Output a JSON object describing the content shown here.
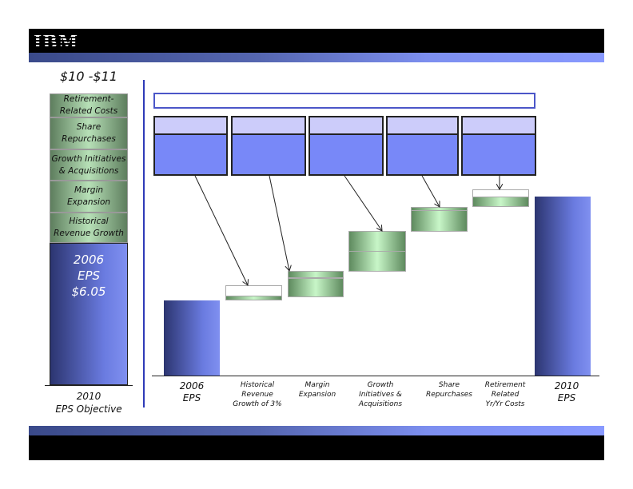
{
  "header": {
    "logo": "IBM"
  },
  "objective": {
    "range": "$10 -$11",
    "blocks": [
      "Retirement-Related Costs",
      "Share Repurchases",
      "Growth Initiatives & Acquisitions",
      "Margin Expansion",
      "Historical Revenue Growth"
    ],
    "base_year": "2006",
    "base_label": "EPS",
    "base_value": "$6.05",
    "footer_year": "2010",
    "footer_label": "EPS Objective"
  },
  "chart_data": {
    "type": "bar",
    "subtype": "waterfall",
    "categories": [
      "2006 EPS",
      "Historical Revenue Growth of 3%",
      "Margin Expansion",
      "Growth Initiatives & Acquisitions",
      "Share Repurchases",
      "Retirement Related Yr/Yr Costs",
      "2010 EPS"
    ],
    "labels": [
      {
        "l1": "2006",
        "l2": "EPS"
      },
      {
        "l1": "Historical",
        "l2": "Revenue",
        "l3": "Growth of 3%"
      },
      {
        "l1": "Margin",
        "l2": "Expansion"
      },
      {
        "l1": "Growth",
        "l2": "Initiatives &",
        "l3": "Acquisitions"
      },
      {
        "l1": "Share",
        "l2": "Repurchases"
      },
      {
        "l1": "Retirement",
        "l2": "Related",
        "l3": "Yr/Yr Costs"
      },
      {
        "l1": "2010",
        "l2": "EPS"
      }
    ],
    "colors": {
      "total": "#6a7be0",
      "step": "#b7e0b7",
      "callout": "#7888f8",
      "callout_header": "#ccccfa"
    }
  }
}
